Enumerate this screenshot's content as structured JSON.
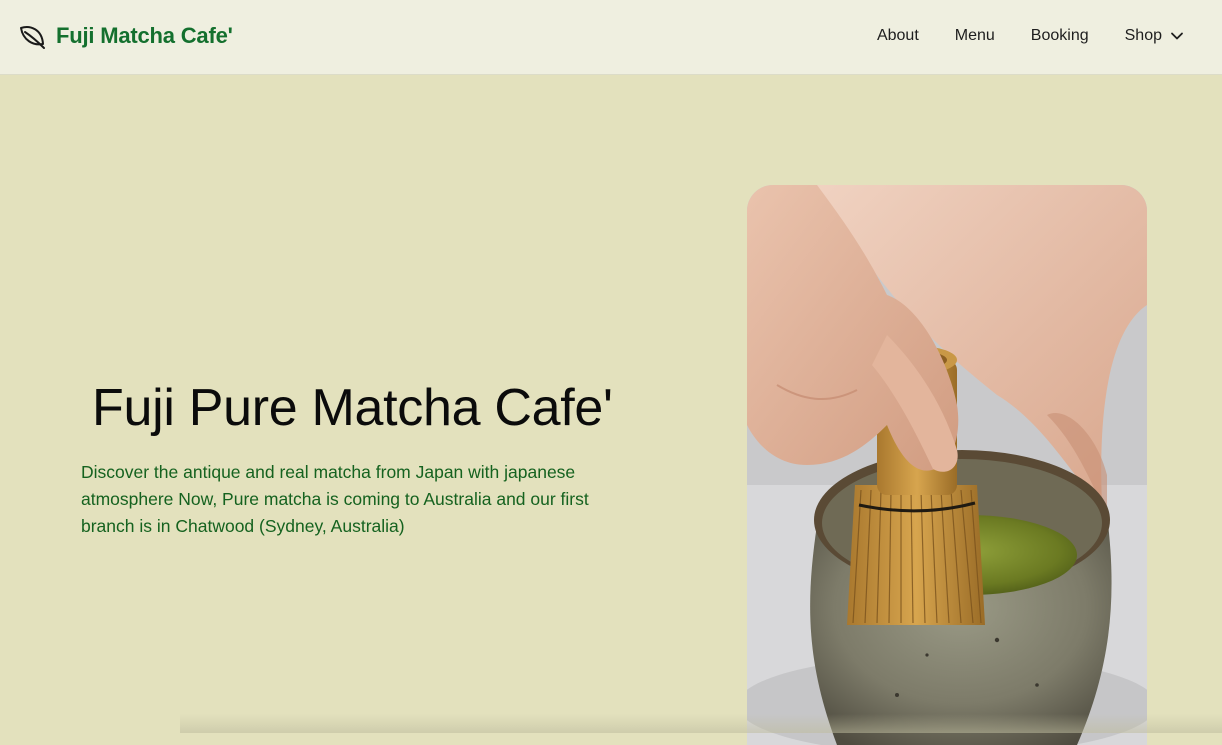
{
  "header": {
    "brand_name": "Fuji Matcha Cafe'",
    "logo_icon": "leaf-icon",
    "nav": [
      {
        "label": "About"
      },
      {
        "label": "Menu"
      },
      {
        "label": "Booking"
      },
      {
        "label": "Shop",
        "icon": "chevron-down-icon"
      }
    ]
  },
  "hero": {
    "title": "Fuji Pure Matcha Cafe'",
    "description": "Discover the antique and real matcha from Japan with japanese atmosphere Now, Pure matcha is coming to Australia and our first branch is in Chatwood (Sydney, Australia)",
    "image_subject": "hands whisking matcha in a ceramic bowl"
  },
  "colors": {
    "page_background": "#e3e1bd",
    "navbar_background": "#efefe0",
    "brand_green": "#14702e",
    "description_green": "#15621f"
  }
}
